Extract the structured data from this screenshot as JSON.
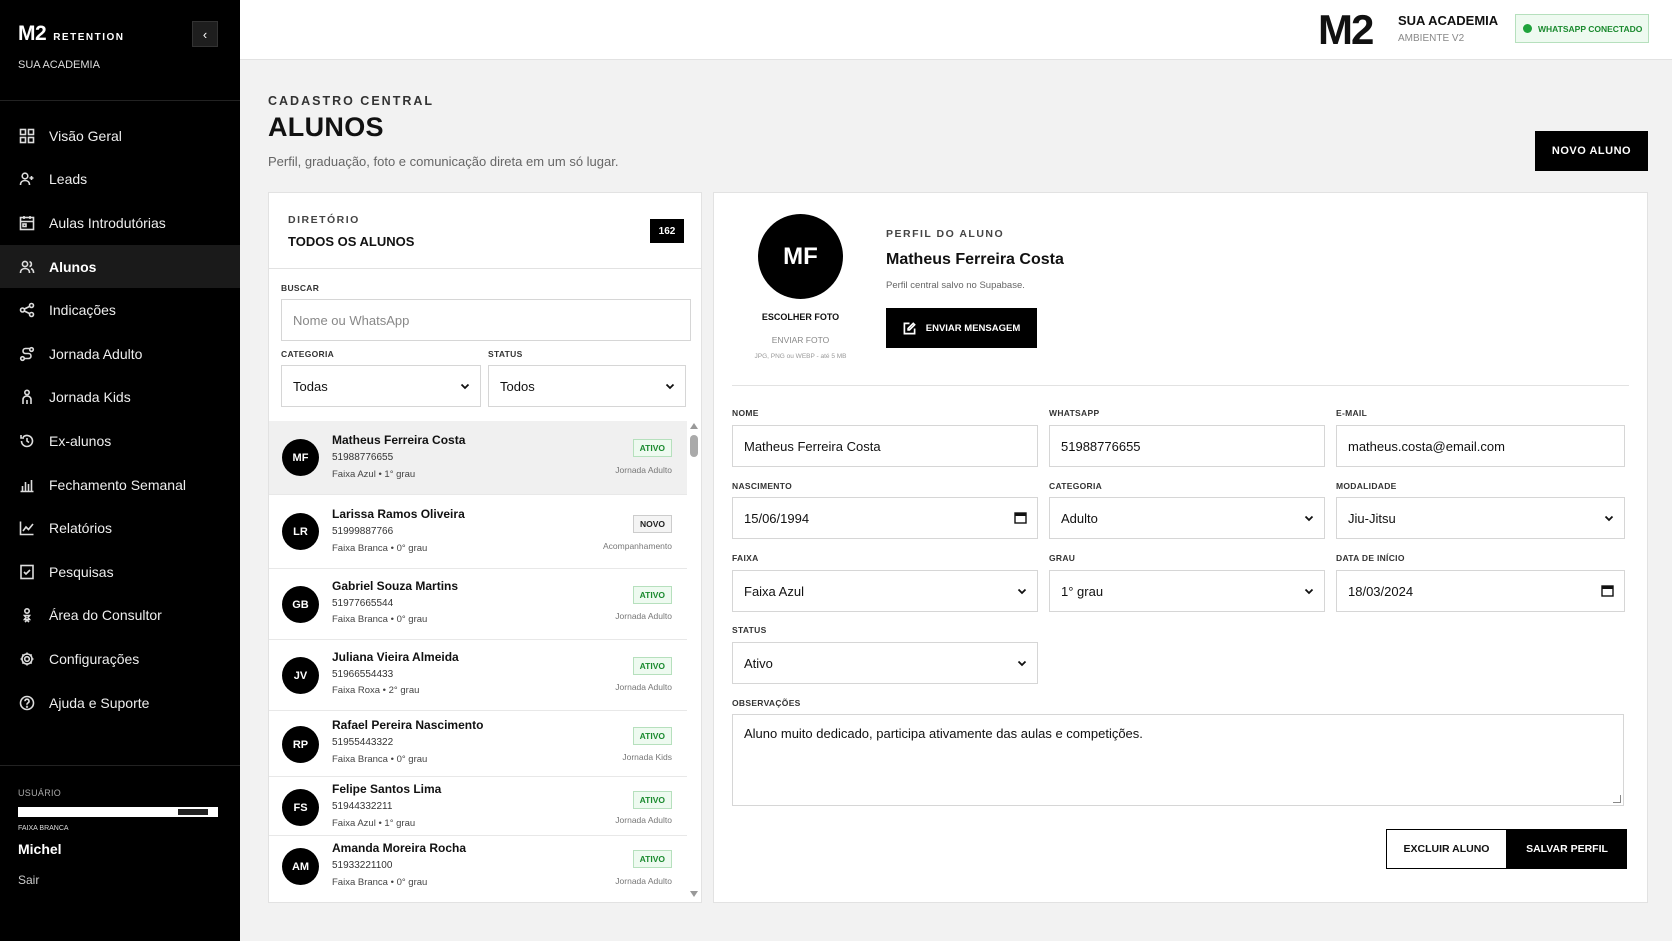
{
  "sidebar": {
    "brand": "M2",
    "brand_sub": "RETENTION",
    "academy": "SUA ACADEMIA",
    "collapse": "‹",
    "items": [
      {
        "label": "Visão Geral",
        "icon": "grid-icon"
      },
      {
        "label": "Leads",
        "icon": "user-plus-icon"
      },
      {
        "label": "Aulas Introdutórias",
        "icon": "calendar-icon"
      },
      {
        "label": "Alunos",
        "icon": "users-icon",
        "active": true
      },
      {
        "label": "Indicações",
        "icon": "share-icon"
      },
      {
        "label": "Jornada Adulto",
        "icon": "route-icon"
      },
      {
        "label": "Jornada Kids",
        "icon": "child-icon"
      },
      {
        "label": "Ex-alunos",
        "icon": "history-icon"
      },
      {
        "label": "Fechamento Semanal",
        "icon": "bar-chart-icon"
      },
      {
        "label": "Relatórios",
        "icon": "line-chart-icon"
      },
      {
        "label": "Pesquisas",
        "icon": "checklist-icon"
      },
      {
        "label": "Área do Consultor",
        "icon": "consultant-icon"
      },
      {
        "label": "Configurações",
        "icon": "gear-icon"
      },
      {
        "label": "Ajuda e Suporte",
        "icon": "help-icon"
      }
    ],
    "user_label": "USUÁRIO",
    "belt_label": "FAIXA BRANCA",
    "user_name": "Michel",
    "logout": "Sair"
  },
  "topbar": {
    "logo": "M2",
    "academy": "SUA ACADEMIA",
    "env": "AMBIENTE V2",
    "whatsapp_status": "WHATSAPP CONECTADO",
    "status_color": "#1fa33b"
  },
  "header": {
    "eyebrow": "CADASTRO CENTRAL",
    "title": "ALUNOS",
    "subtitle": "Perfil, graduação, foto e comunicação direta em um só lugar.",
    "new_button": "NOVO ALUNO"
  },
  "directory": {
    "eyebrow": "DIRETÓRIO",
    "title": "TODOS OS ALUNOS",
    "count": "162",
    "search_label": "BUSCAR",
    "search_placeholder": "Nome ou WhatsApp",
    "category_label": "CATEGORIA",
    "category_value": "Todas",
    "status_label": "STATUS",
    "status_value": "Todos",
    "students": [
      {
        "initials": "MF",
        "name": "Matheus Ferreira Costa",
        "phone": "51988776655",
        "belt": "Faixa Azul • 1° grau",
        "status": "ATIVO",
        "journey": "Jornada Adulto"
      },
      {
        "initials": "LR",
        "name": "Larissa Ramos Oliveira",
        "phone": "51999887766",
        "belt": "Faixa Branca • 0° grau",
        "status": "NOVO",
        "journey": "Acompanhamento"
      },
      {
        "initials": "GB",
        "name": "Gabriel Souza Martins",
        "phone": "51977665544",
        "belt": "Faixa Branca • 0° grau",
        "status": "ATIVO",
        "journey": "Jornada Adulto"
      },
      {
        "initials": "JV",
        "name": "Juliana Vieira Almeida",
        "phone": "51966554433",
        "belt": "Faixa Roxa • 2° grau",
        "status": "ATIVO",
        "journey": "Jornada Adulto"
      },
      {
        "initials": "RP",
        "name": "Rafael Pereira Nascimento",
        "phone": "51955443322",
        "belt": "Faixa Branca • 0° grau",
        "status": "ATIVO",
        "journey": "Jornada Kids"
      },
      {
        "initials": "FS",
        "name": "Felipe Santos Lima",
        "phone": "51944332211",
        "belt": "Faixa Azul • 1° grau",
        "status": "ATIVO",
        "journey": "Jornada Adulto"
      },
      {
        "initials": "AM",
        "name": "Amanda Moreira Rocha",
        "phone": "51933221100",
        "belt": "Faixa Branca • 0° grau",
        "status": "ATIVO",
        "journey": "Jornada Adulto"
      }
    ]
  },
  "profile": {
    "initials": "MF",
    "choose_photo": "ESCOLHER FOTO",
    "send_photo": "ENVIAR FOTO",
    "photo_hint": "JPG, PNG ou WEBP - até 5 MB",
    "eyebrow": "PERFIL DO ALUNO",
    "name": "Matheus Ferreira Costa",
    "saved_note": "Perfil central salvo no Supabase.",
    "message_button": "ENVIAR MENSAGEM",
    "fields": {
      "nome_label": "NOME",
      "nome": "Matheus Ferreira Costa",
      "whatsapp_label": "WHATSAPP",
      "whatsapp": "51988776655",
      "email_label": "E-MAIL",
      "email": "matheus.costa@email.com",
      "nascimento_label": "NASCIMENTO",
      "nascimento": "15/06/1994",
      "categoria_label": "CATEGORIA",
      "categoria": "Adulto",
      "modalidade_label": "MODALIDADE",
      "modalidade": "Jiu-Jitsu",
      "faixa_label": "FAIXA",
      "faixa": "Faixa Azul",
      "grau_label": "GRAU",
      "grau": "1° grau",
      "inicio_label": "DATA DE INÍCIO",
      "inicio": "18/03/2024",
      "status_label": "STATUS",
      "status": "Ativo",
      "obs_label": "OBSERVAÇÕES",
      "obs": "Aluno muito dedicado, participa ativamente das aulas e competições."
    },
    "delete_button": "EXCLUIR ALUNO",
    "save_button": "SALVAR PERFIL"
  }
}
